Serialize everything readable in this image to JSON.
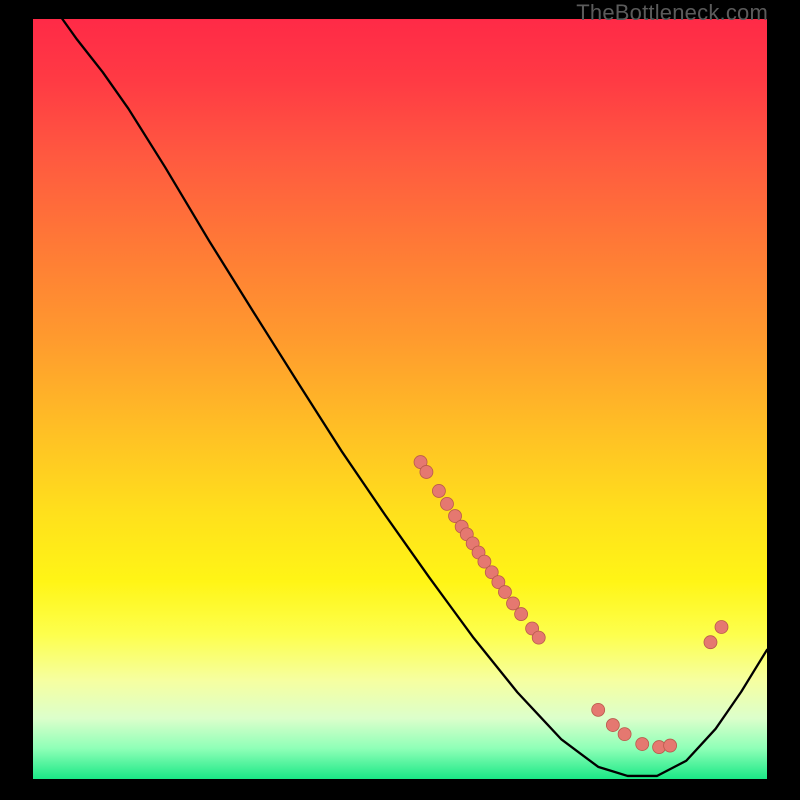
{
  "watermark": "TheBottleneck.com",
  "chart_data": {
    "type": "line",
    "title": "",
    "xlabel": "",
    "ylabel": "",
    "xlim": [
      0,
      100
    ],
    "ylim": [
      0,
      100
    ],
    "grid": false,
    "legend": false,
    "curve": [
      {
        "x": 4.0,
        "y": 100.0
      },
      {
        "x": 6.0,
        "y": 97.3
      },
      {
        "x": 9.5,
        "y": 93.0
      },
      {
        "x": 13.0,
        "y": 88.2
      },
      {
        "x": 18.0,
        "y": 80.5
      },
      {
        "x": 24.0,
        "y": 70.8
      },
      {
        "x": 30.0,
        "y": 61.5
      },
      {
        "x": 36.0,
        "y": 52.3
      },
      {
        "x": 42.0,
        "y": 43.2
      },
      {
        "x": 48.0,
        "y": 34.7
      },
      {
        "x": 54.0,
        "y": 26.5
      },
      {
        "x": 60.0,
        "y": 18.6
      },
      {
        "x": 66.0,
        "y": 11.4
      },
      {
        "x": 72.0,
        "y": 5.2
      },
      {
        "x": 77.0,
        "y": 1.6
      },
      {
        "x": 81.0,
        "y": 0.4
      },
      {
        "x": 85.0,
        "y": 0.4
      },
      {
        "x": 89.0,
        "y": 2.4
      },
      {
        "x": 93.0,
        "y": 6.6
      },
      {
        "x": 96.5,
        "y": 11.5
      },
      {
        "x": 100.0,
        "y": 17.0
      }
    ],
    "markers": [
      {
        "x": 52.8,
        "y": 41.7
      },
      {
        "x": 53.6,
        "y": 40.4
      },
      {
        "x": 55.3,
        "y": 37.9
      },
      {
        "x": 56.4,
        "y": 36.2
      },
      {
        "x": 57.5,
        "y": 34.6
      },
      {
        "x": 58.4,
        "y": 33.2
      },
      {
        "x": 59.1,
        "y": 32.2
      },
      {
        "x": 59.9,
        "y": 31.0
      },
      {
        "x": 60.7,
        "y": 29.8
      },
      {
        "x": 61.5,
        "y": 28.6
      },
      {
        "x": 62.5,
        "y": 27.2
      },
      {
        "x": 63.4,
        "y": 25.9
      },
      {
        "x": 64.3,
        "y": 24.6
      },
      {
        "x": 65.4,
        "y": 23.1
      },
      {
        "x": 66.5,
        "y": 21.7
      },
      {
        "x": 68.0,
        "y": 19.8
      },
      {
        "x": 68.9,
        "y": 18.6
      },
      {
        "x": 77.0,
        "y": 9.1
      },
      {
        "x": 79.0,
        "y": 7.1
      },
      {
        "x": 80.6,
        "y": 5.9
      },
      {
        "x": 83.0,
        "y": 4.6
      },
      {
        "x": 85.3,
        "y": 4.2
      },
      {
        "x": 86.8,
        "y": 4.4
      },
      {
        "x": 92.3,
        "y": 18.0
      },
      {
        "x": 93.8,
        "y": 20.0
      }
    ],
    "marker_color": "#e57870",
    "curve_color": "#000000"
  }
}
